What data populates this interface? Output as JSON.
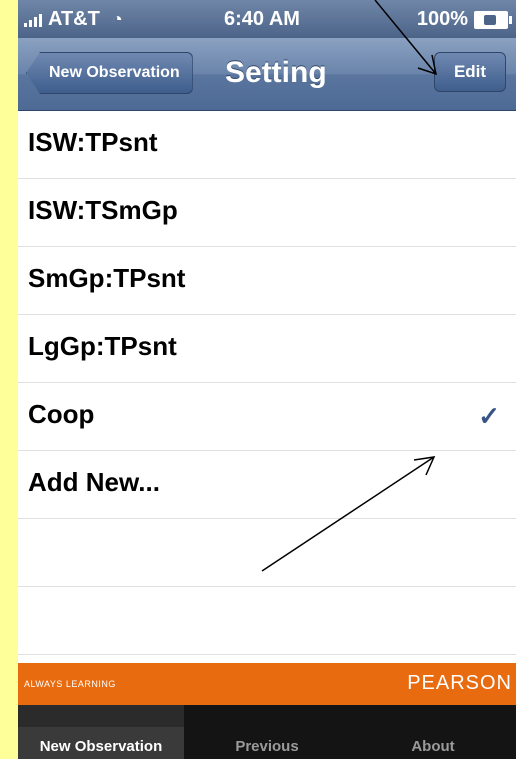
{
  "status_bar": {
    "carrier": "AT&T",
    "time": "6:40 AM",
    "battery": "100%"
  },
  "nav": {
    "back_label": "New Observation",
    "title": "Setting",
    "edit_label": "Edit"
  },
  "list": {
    "items": [
      {
        "label": "ISW:TPsnt",
        "checked": false
      },
      {
        "label": "ISW:TSmGp",
        "checked": false
      },
      {
        "label": "SmGp:TPsnt",
        "checked": false
      },
      {
        "label": "LgGp:TPsnt",
        "checked": false
      },
      {
        "label": "Coop",
        "checked": true,
        "check_mark": "✓"
      },
      {
        "label": "Add New...",
        "checked": false
      }
    ]
  },
  "banner": {
    "tagline": "ALWAYS LEARNING",
    "brand": "PEARSON",
    "color": "#e96b10"
  },
  "tabbar": {
    "tabs": [
      {
        "label": "New Observation",
        "active": true
      },
      {
        "label": "Previous",
        "active": false
      },
      {
        "label": "About",
        "active": false
      }
    ]
  },
  "colors": {
    "page_background": "#ffff99",
    "nav_accent": "#4d6a95",
    "check": "#385487"
  }
}
